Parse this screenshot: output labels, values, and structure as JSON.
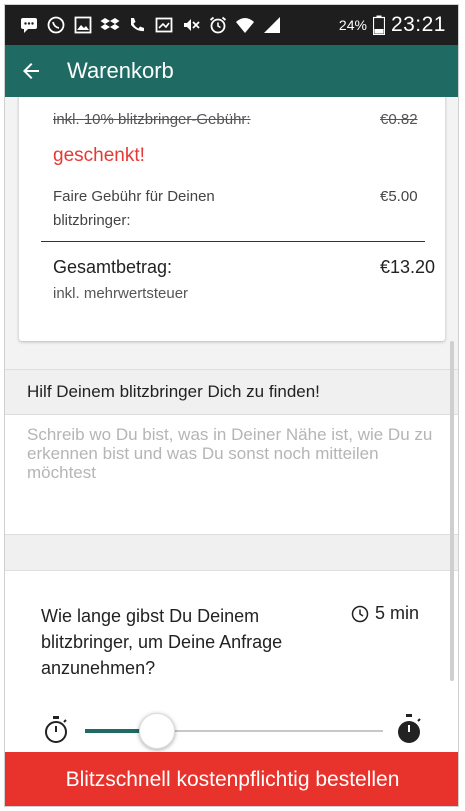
{
  "status_bar": {
    "battery_percent": "24%",
    "time": "23:21",
    "icons": [
      "message-icon",
      "whatsapp-icon",
      "gallery-icon",
      "dropbox-icon",
      "phone-icon",
      "screenshot-icon",
      "mute-icon",
      "alarm-icon",
      "wifi-icon",
      "signal-icon",
      "battery-icon"
    ]
  },
  "app_bar": {
    "title": "Warenkorb",
    "back_icon": "arrow-left-icon"
  },
  "summary": {
    "service_fee_label": "inkl. 10% blitzbringer-Gebühr:",
    "service_fee_value": "€0.82",
    "gift_label": "geschenkt!",
    "fair_fee_label_line1": "Faire Gebühr für Deinen",
    "fair_fee_label_line2": "blitzbringer:",
    "fair_fee_value": "€5.00",
    "total_label": "Gesamtbetrag:",
    "total_value": "€13.20",
    "vat_note": "inkl. mehrwertsteuer"
  },
  "location": {
    "heading": "Hilf Deinem blitzbringer Dich zu finden!",
    "placeholder": "Schreib wo Du bist, was in Deiner Nähe ist, wie Du zu erkennen bist und was Du sonst noch mitteilen möchtest",
    "value": ""
  },
  "wait_time": {
    "question": "Wie lange gibst Du Deinem blitzbringer, um Deine Anfrage anzunehmen?",
    "value_label": "5 min",
    "clock_icon": "clock-icon",
    "slider_fraction": 0.24,
    "min_icon": "stopwatch-empty-icon",
    "max_icon": "stopwatch-full-icon"
  },
  "actions": {
    "order_button_label": "Blitzschnell kostenpflichtig bestellen"
  },
  "colors": {
    "primary": "#1f6b64",
    "accent_red": "#e8322c",
    "gift_red": "#e53935"
  }
}
